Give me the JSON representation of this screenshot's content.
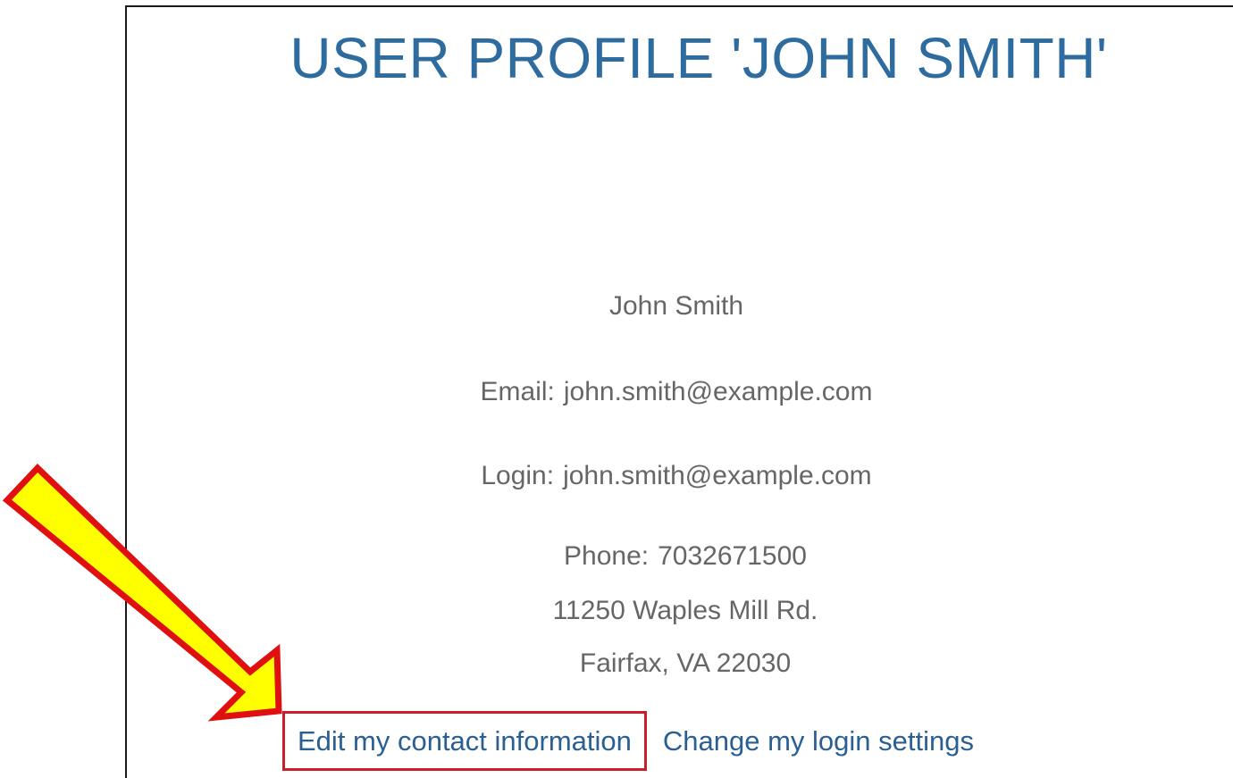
{
  "page": {
    "title": "USER PROFILE 'JOHN SMITH'"
  },
  "profile": {
    "name": "John Smith",
    "email_label": "Email:",
    "email": "john.smith@example.com",
    "login_label": "Login:",
    "login": "john.smith@example.com",
    "phone_label": "Phone:",
    "phone": "7032671500",
    "address_line1": "11250 Waples Mill Rd.",
    "address_line2": "Fairfax, VA  22030"
  },
  "actions": {
    "edit_contact": "Edit my contact information",
    "change_login": "Change my login settings"
  },
  "annotation": {
    "arrow_fill": "#ffff00",
    "arrow_stroke": "#e01010",
    "highlight_box": "#c8202a"
  },
  "colors": {
    "title": "#2e6b9e",
    "link": "#2a5f93",
    "text": "#666666"
  }
}
